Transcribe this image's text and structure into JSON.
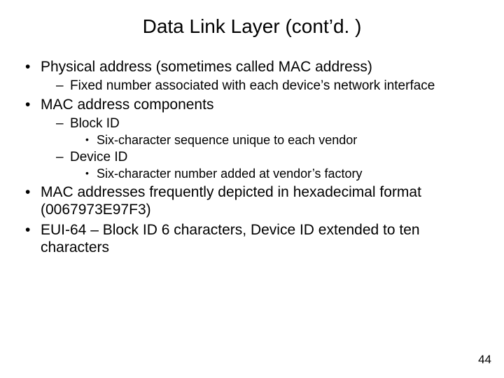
{
  "title": "Data Link Layer (cont’d. )",
  "bullets": {
    "b1": {
      "text": "Physical address (sometimes called MAC address)",
      "sub": {
        "s1": "Fixed number associated with each device’s network interface"
      }
    },
    "b2": {
      "text": "MAC address components",
      "sub": {
        "s1": {
          "text": "Block ID",
          "sub": {
            "t1": "Six-character sequence unique to each vendor"
          }
        },
        "s2": {
          "text": "Device ID",
          "sub": {
            "t1": "Six-character number added at vendor’s factory"
          }
        }
      }
    },
    "b3": {
      "text": "MAC addresses frequently depicted in hexadecimal format (0067973E97F3)"
    },
    "b4": {
      "text": "EUI-64 – Block ID 6 characters, Device ID extended to ten characters"
    }
  },
  "page_number": "44"
}
